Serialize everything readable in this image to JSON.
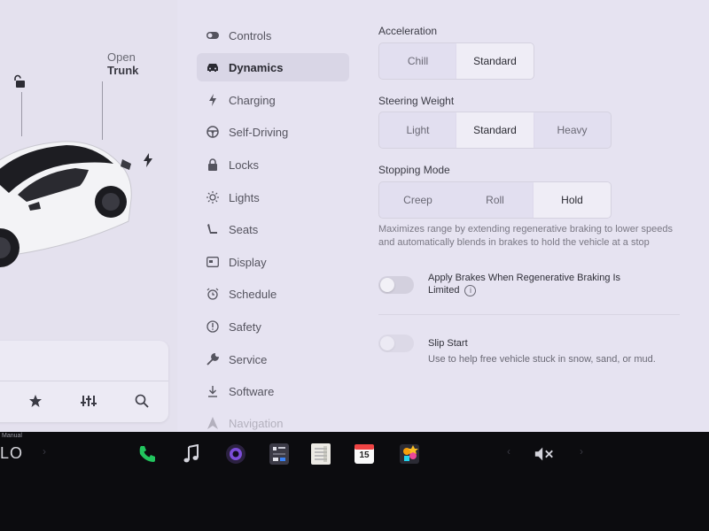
{
  "left_panel": {
    "trunk_top": "Open",
    "trunk_bottom": "Trunk"
  },
  "menu": [
    {
      "label": "Controls",
      "icon": "toggle-icon",
      "active": false
    },
    {
      "label": "Dynamics",
      "icon": "car-icon",
      "active": true
    },
    {
      "label": "Charging",
      "icon": "bolt-icon",
      "active": false
    },
    {
      "label": "Self-Driving",
      "icon": "steering-wheel-icon",
      "active": false
    },
    {
      "label": "Locks",
      "icon": "lock-icon",
      "active": false
    },
    {
      "label": "Lights",
      "icon": "sun-icon",
      "active": false
    },
    {
      "label": "Seats",
      "icon": "seat-icon",
      "active": false
    },
    {
      "label": "Display",
      "icon": "display-icon",
      "active": false
    },
    {
      "label": "Schedule",
      "icon": "alarm-clock-icon",
      "active": false
    },
    {
      "label": "Safety",
      "icon": "info-circle-icon",
      "active": false
    },
    {
      "label": "Service",
      "icon": "wrench-icon",
      "active": false
    },
    {
      "label": "Software",
      "icon": "download-icon",
      "active": false
    },
    {
      "label": "Navigation",
      "icon": "navigation-icon",
      "active": false
    }
  ],
  "settings": {
    "acceleration": {
      "title": "Acceleration",
      "options": [
        "Chill",
        "Standard"
      ],
      "selected": "Standard"
    },
    "steering_weight": {
      "title": "Steering Weight",
      "options": [
        "Light",
        "Standard",
        "Heavy"
      ],
      "selected": "Standard"
    },
    "stopping_mode": {
      "title": "Stopping Mode",
      "options": [
        "Creep",
        "Roll",
        "Hold"
      ],
      "selected": "Hold",
      "description": "Maximizes range by extending regenerative braking to lower speeds and automatically blends in brakes to hold the vehicle at a stop"
    },
    "apply_brakes": {
      "title": "Apply Brakes When Regenerative Braking Is Limited",
      "enabled": false
    },
    "slip_start": {
      "title": "Slip Start",
      "subtitle": "Use to help free vehicle stuck in snow, sand, or mud.",
      "enabled": false
    }
  },
  "dock": {
    "climate_mode": "Manual",
    "climate_value": "LO",
    "calendar_day": "15",
    "volume_state": "muted"
  }
}
